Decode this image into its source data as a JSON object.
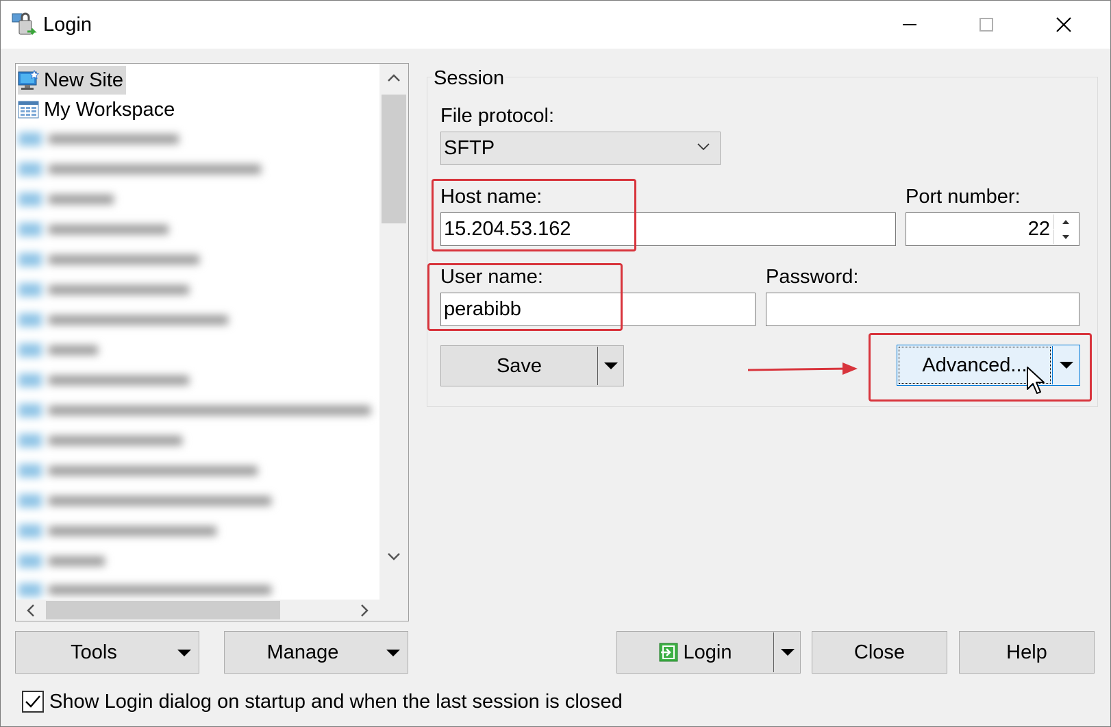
{
  "window": {
    "title": "Login",
    "controls": {
      "minimize": "minimize",
      "maximize": "maximize",
      "close": "close"
    }
  },
  "tree": {
    "items": [
      {
        "label": "New Site",
        "icon": "new-site-icon",
        "selected": true
      },
      {
        "label": "My Workspace",
        "icon": "workspace-icon",
        "selected": false
      }
    ]
  },
  "session": {
    "group_label": "Session",
    "file_protocol_label": "File protocol:",
    "file_protocol_value": "SFTP",
    "host_name_label": "Host name:",
    "host_name_value": "15.204.53.162",
    "port_number_label": "Port number:",
    "port_number_value": "22",
    "user_name_label": "User name:",
    "user_name_value": "perabibb",
    "password_label": "Password:",
    "password_value": "",
    "save_label": "Save",
    "advanced_label": "Advanced..."
  },
  "footer": {
    "tools_label": "Tools",
    "manage_label": "Manage",
    "login_label": "Login",
    "close_label": "Close",
    "help_label": "Help",
    "show_login_label": "Show Login dialog on startup and when the last session is closed",
    "show_login_checked": true
  },
  "colors": {
    "annotation_red": "#d8343c",
    "focus_blue": "#0078d7",
    "selected_bg": "#d9d9d9"
  }
}
